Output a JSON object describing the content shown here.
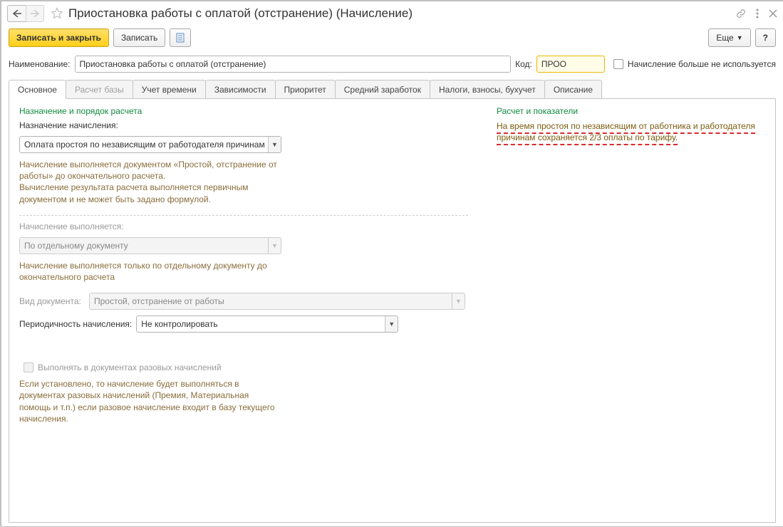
{
  "title": "Приостановка работы с оплатой (отстранение) (Начисление)",
  "toolbar": {
    "save_close": "Записать и закрыть",
    "save": "Записать",
    "more": "Еще",
    "help": "?"
  },
  "header": {
    "name_label": "Наименование:",
    "name_value": "Приостановка работы с оплатой (отстранение)",
    "code_label": "Код:",
    "code_value": "ПРОО ",
    "unused_label": "Начисление больше не используется"
  },
  "tabs": [
    "Основное",
    "Расчет базы",
    "Учет времени",
    "Зависимости",
    "Приоритет",
    "Средний заработок",
    "Налоги, взносы, бухучет",
    "Описание"
  ],
  "main": {
    "section1": "Назначение и порядок расчета",
    "purpose_label": "Назначение начисления:",
    "purpose_value": "Оплата простоя по независящим от работодателя причинам",
    "purpose_hint": "Начисление выполняется документом «Простой, отстранение от работы» до окончательного расчета.\nВычисление результата расчета выполняется первичным документом и не может быть задано формулой.",
    "exec_label": "Начисление выполняется:",
    "exec_value": "По отдельному документу",
    "exec_hint": "Начисление выполняется только по отдельному документу до окончательного расчета",
    "doc_label": "Вид документа:",
    "doc_value": "Простой, отстранение от работы",
    "period_label": "Периодичность начисления:",
    "period_value": "Не контролировать",
    "once_label": "Выполнять в документах разовых начислений",
    "once_hint": "Если установлено, то начисление будет выполняться в документах разовых начислений (Премия, Материальная помощь и т.п.) если разовое начисление входит в базу текущего начисления."
  },
  "right": {
    "title": "Расчет и показатели",
    "text": "На время простоя по независящим от работника и работодателя причинам сохраняется 2/3 оплаты по тарифу."
  }
}
